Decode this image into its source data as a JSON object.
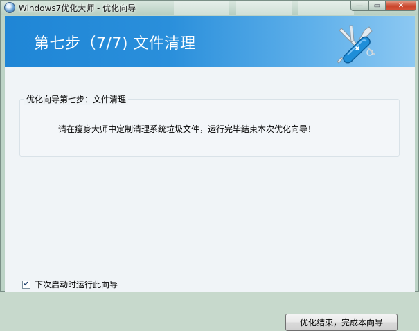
{
  "window": {
    "title": "Windows7优化大师 - 优化向导",
    "minimize_glyph": "—",
    "maximize_glyph": "▭",
    "close_glyph": "✕"
  },
  "banner": {
    "title": "第七步（7/7) 文件清理",
    "icon": "swiss-knife-icon"
  },
  "group": {
    "legend": "优化向导第七步：文件清理",
    "message": "请在瘦身大师中定制清理系统垃圾文件，运行完毕结束本次优化向导！"
  },
  "footer": {
    "checkbox_label": "下次启动时运行此向导",
    "checkbox_checked": true,
    "finish_button": "优化结束，完成本向导"
  },
  "colors": {
    "banner_start": "#1f86d6",
    "banner_end": "#8cc8f2",
    "close_red": "#c9452b"
  }
}
